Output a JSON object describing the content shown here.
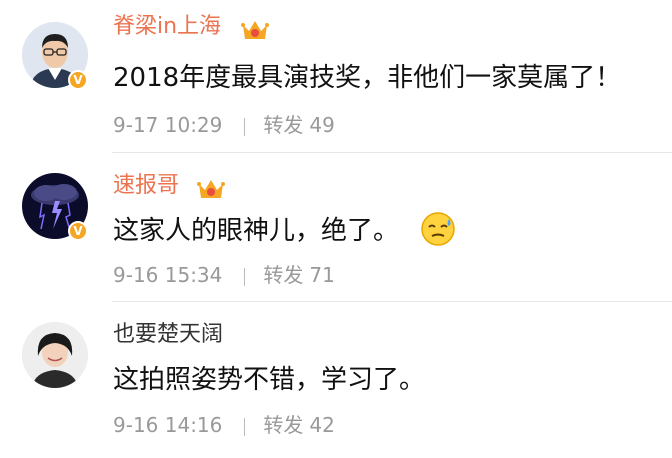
{
  "comments": [
    {
      "username": "脊梁in上海",
      "text": "2018年度最具演技奖，非他们一家莫属了！",
      "time": "9-17 10:29",
      "forward_label": "转发",
      "forward_count": "49",
      "verified": true,
      "crown": true
    },
    {
      "username": "速报哥",
      "text": "这家人的眼神儿，绝了。",
      "time": "9-16 15:34",
      "forward_label": "转发",
      "forward_count": "71",
      "verified": true,
      "crown": true,
      "emoji": "cold-sweat-emoji-icon"
    },
    {
      "username": "也要楚天阔",
      "text": "这拍照姿势不错，学习了。",
      "time": "9-16 14:16",
      "forward_label": "转发",
      "forward_count": "42",
      "verified": false,
      "crown": false
    }
  ],
  "colors": {
    "username_orange": "#eb7350",
    "meta_gray": "#999999",
    "verified_badge": "#f5a623"
  }
}
